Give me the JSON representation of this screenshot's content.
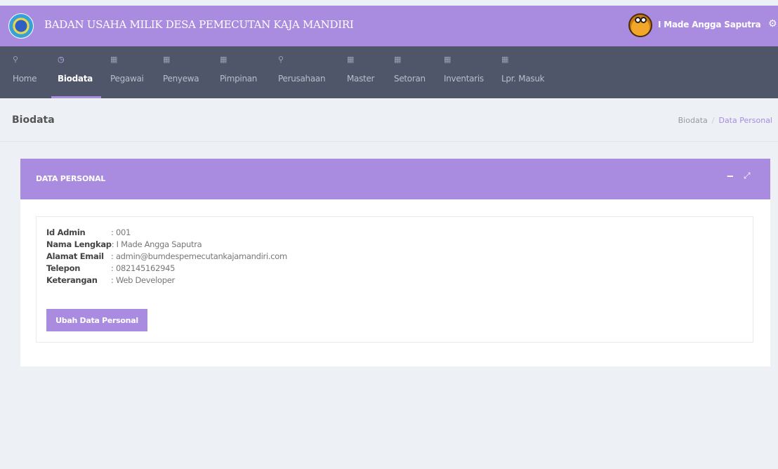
{
  "header": {
    "title": "BADAN USAHA MILIK DESA PEMECUTAN KAJA MANDIRI",
    "user_name": "I Made Angga Saputra",
    "logo_icon": "bumdes-logo",
    "avatar_icon": "user-avatar",
    "settings_icon": "gear-icon"
  },
  "nav": {
    "items": [
      {
        "label": "Home",
        "icon": "wrench-icon"
      },
      {
        "label": "Biodata",
        "icon": "clock-icon",
        "active": true
      },
      {
        "label": "Pegawai",
        "icon": "calendar-icon"
      },
      {
        "label": "Penyewa",
        "icon": "calendar-icon"
      },
      {
        "label": "Pimpinan",
        "icon": "calendar-icon"
      },
      {
        "label": "Perusahaan",
        "icon": "wrench-icon"
      },
      {
        "label": "Master",
        "icon": "calendar-icon"
      },
      {
        "label": "Setoran",
        "icon": "calendar-icon"
      },
      {
        "label": "Inventaris",
        "icon": "calendar-icon"
      },
      {
        "label": "Lpr. Masuk",
        "icon": "calendar-icon"
      }
    ]
  },
  "page": {
    "title": "Biodata",
    "breadcrumb": [
      "Biodata",
      "Data Personal"
    ]
  },
  "card": {
    "title": "DATA PERSONAL",
    "fields": [
      {
        "label": "Id Admin",
        "value": "001"
      },
      {
        "label": "Nama Lengkap",
        "value": "I Made Angga Saputra"
      },
      {
        "label": "Alamat Email",
        "value": "admin@bumdespemecutankajamandiri.com"
      },
      {
        "label": "Telepon",
        "value": "082145162945"
      },
      {
        "label": "Keterangan",
        "value": "Web Developer"
      }
    ],
    "button_label": "Ubah Data Personal"
  },
  "colors": {
    "accent": "#a98be0",
    "nav_bg": "#50566a",
    "page_bg": "#edf0f5"
  }
}
